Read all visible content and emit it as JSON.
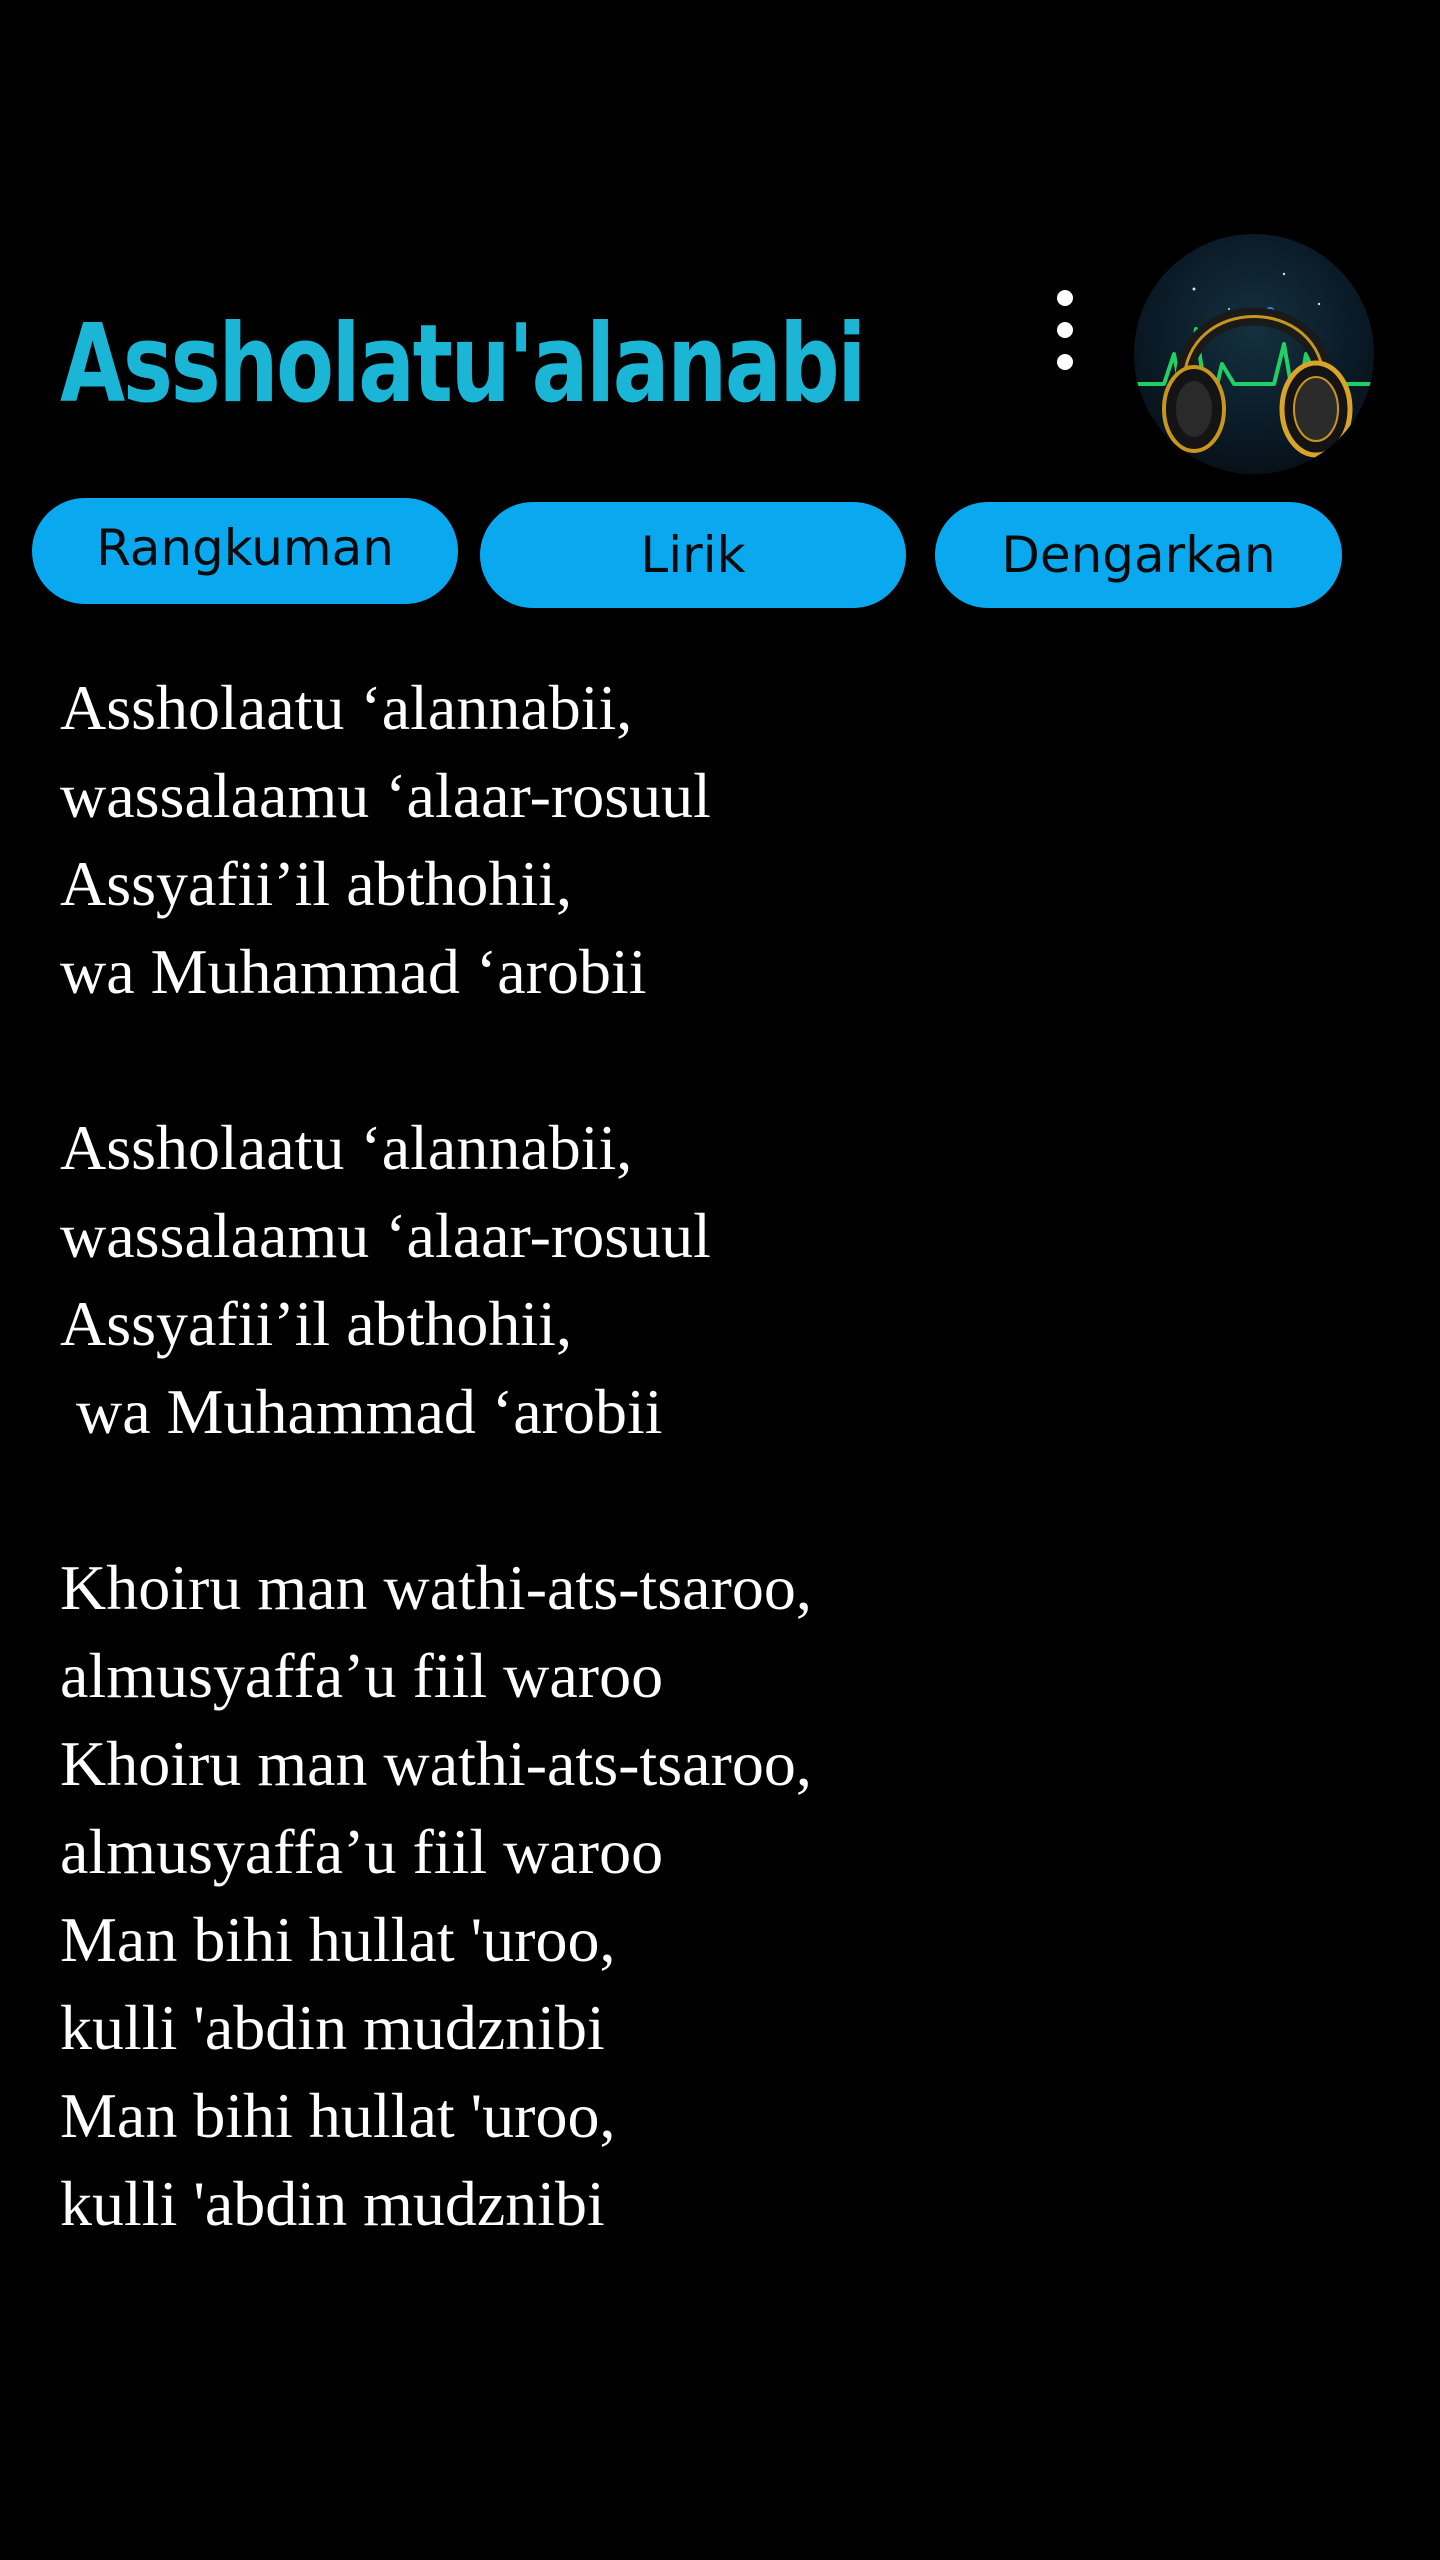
{
  "header": {
    "title": "Assholatu'alanabi",
    "menu_icon": "more-vertical-icon",
    "avatar_icon": "headphones-icon"
  },
  "tabs": [
    {
      "label": "Rangkuman"
    },
    {
      "label": "Lirik"
    },
    {
      "label": "Dengarkan"
    }
  ],
  "lyrics": {
    "stanzas": [
      {
        "lines": [
          "Assholaatu ‘alannabii,",
          "wassalaamu ‘alaar-rosuul",
          "Assyafii’il abthohii,",
          "wa Muhammad ‘arobii"
        ]
      },
      {
        "lines": [
          "Assholaatu ‘alannabii,",
          "wassalaamu ‘alaar-rosuul",
          "Assyafii’il abthohii,",
          " wa Muhammad ‘arobii"
        ]
      },
      {
        "lines": [
          "Khoiru man wathi-ats-tsaroo,",
          "almusyaffa’u fiil waroo",
          "Khoiru man wathi-ats-tsaroo,",
          "almusyaffa’u fiil waroo",
          "Man bihi hullat 'uroo,",
          "kulli 'abdin mudznibi",
          "Man bihi hullat 'uroo,",
          "kulli 'abdin mudznibi"
        ]
      }
    ]
  },
  "colors": {
    "background": "#000000",
    "title": "#1bb5d6",
    "tab_background": "#0aa9ef",
    "tab_text": "#0a0a0a",
    "lyric_text": "#ffffff"
  }
}
